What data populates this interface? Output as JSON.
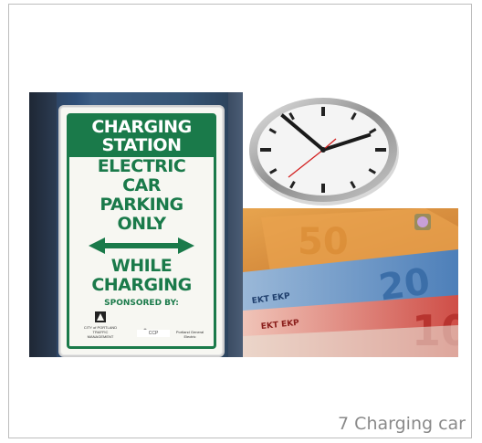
{
  "slide": {
    "caption": "7 Charging car"
  },
  "sign": {
    "header_lines": [
      "CHARGING",
      "STATION"
    ],
    "body_lines": [
      "ELECTRIC",
      "CAR",
      "PARKING",
      "ONLY"
    ],
    "lower_lines": [
      "WHILE",
      "CHARGING"
    ],
    "sponsored_label": "SPONSORED BY:",
    "logos": [
      {
        "name": "CITY of PORTLAND TRAFFIC MANAGEMENT"
      },
      {
        "name": ""
      },
      {
        "name": "Portland General Electric"
      }
    ],
    "code": "CCP"
  },
  "images": {
    "left": "charging-station-sign",
    "top_right": "wall-clock",
    "bottom_right": "euro-banknotes"
  },
  "euro": {
    "labels": [
      "EKT EKP",
      "20",
      "10",
      "50"
    ]
  },
  "colors": {
    "sign_green": "#1a7a4a",
    "caption_gray": "#8a8a8a",
    "euro_blue": "#5f8fc4",
    "euro_red": "#d7695f",
    "euro_orange": "#e08a3c"
  }
}
